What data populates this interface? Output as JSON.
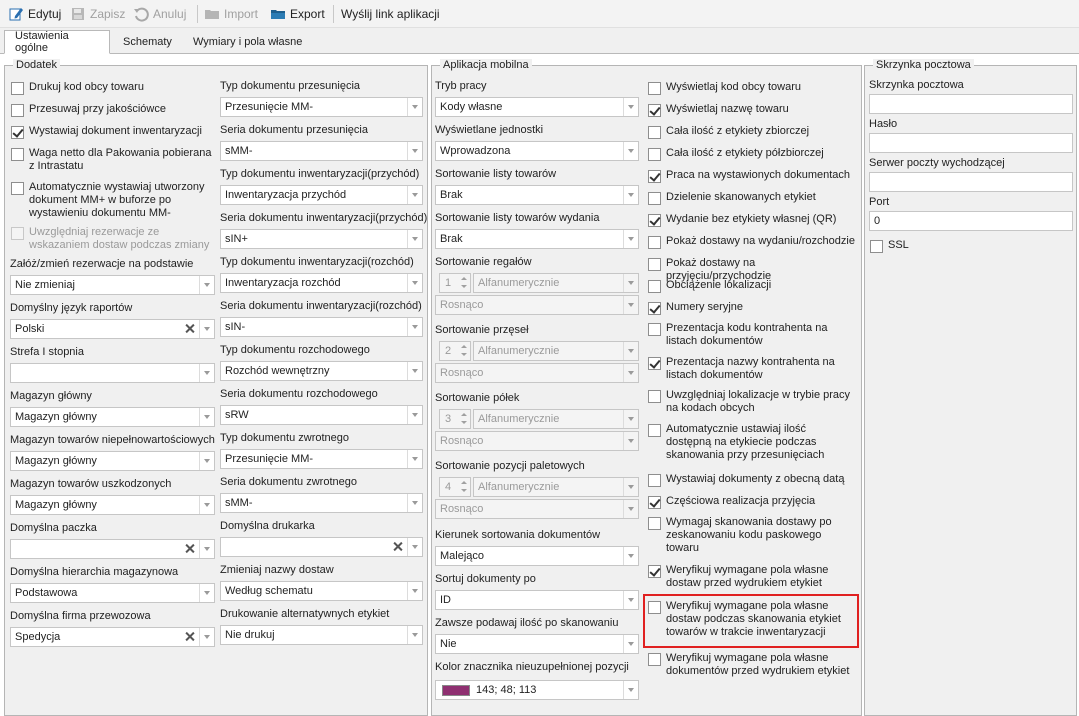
{
  "toolbar": {
    "edit": "Edytuj",
    "save": "Zapisz",
    "cancel": "Anuluj",
    "import": "Import",
    "export": "Export",
    "send_link": "Wyślij link aplikacji"
  },
  "tabs": [
    "Ustawienia ogólne",
    "Schematy",
    "Wymiary i pola własne"
  ],
  "dodatek": {
    "title": "Dodatek",
    "checkboxes": [
      {
        "label": "Drukuj kod obcy towaru",
        "checked": false
      },
      {
        "label": "Przesuwaj przy jakościówce",
        "checked": false
      },
      {
        "label": "Wystawiaj dokument inwentaryzacji",
        "checked": true
      },
      {
        "label": "Waga netto dla Pakowania pobierana\nz Intrastatu",
        "checked": false
      },
      {
        "label": "Automatycznie wystawiaj utworzony\ndokument MM+ w buforze po\nwystawieniu dokumentu MM-",
        "checked": false
      },
      {
        "label": "Uwzględniaj rezerwacje ze\nwskazaniem dostaw podczas zmiany",
        "checked": false,
        "disabled": true
      }
    ],
    "left_fields": [
      {
        "label": "Załóż/zmień rezerwacje na podstawie",
        "value": "Nie zmieniaj"
      },
      {
        "label": "Domyślny język raportów",
        "value": "Polski"
      },
      {
        "label": "Strefa I stopnia",
        "value": ""
      },
      {
        "label": "Magazyn główny",
        "value": "Magazyn główny"
      },
      {
        "label": "Magazyn towarów niepełnowartościowych",
        "value": "Magazyn główny"
      },
      {
        "label": "Magazyn towarów uszkodzonych",
        "value": "Magazyn główny"
      },
      {
        "label": "Domyślna paczka",
        "value": ""
      },
      {
        "label": "Domyślna hierarchia magazynowa",
        "value": "Podstawowa"
      },
      {
        "label": "Domyślna firma przewozowa",
        "value": "Spedycja"
      }
    ],
    "right_fields": [
      {
        "label": "Typ dokumentu przesunięcia",
        "value": "Przesunięcie MM-"
      },
      {
        "label": "Seria dokumentu przesunięcia",
        "value": "sMM-"
      },
      {
        "label": "Typ dokumentu inwentaryzacji(przychód)",
        "value": "Inwentaryzacja przychód"
      },
      {
        "label": "Seria dokumentu inwentaryzacji(przychód)",
        "value": "sIN+"
      },
      {
        "label": "Typ dokumentu inwentaryzacji(rozchód)",
        "value": "Inwentaryzacja rozchód"
      },
      {
        "label": "Seria dokumentu inwentaryzacji(rozchód)",
        "value": "sIN-"
      },
      {
        "label": "Typ dokumentu rozchodowego",
        "value": "Rozchód wewnętrzny"
      },
      {
        "label": "Seria dokumentu rozchodowego",
        "value": "sRW"
      },
      {
        "label": "Typ dokumentu zwrotnego",
        "value": "Przesunięcie MM-"
      },
      {
        "label": "Seria dokumentu zwrotnego",
        "value": "sMM-"
      },
      {
        "label": "Domyślna drukarka",
        "value": ""
      },
      {
        "label": "Zmieniaj nazwy dostaw",
        "value": "Według schematu"
      },
      {
        "label": "Drukowanie alternatywnych etykiet",
        "value": "Nie drukuj"
      }
    ]
  },
  "mobile": {
    "title": "Aplikacja mobilna",
    "fields": [
      {
        "label": "Tryb pracy",
        "value": "Kody własne"
      },
      {
        "label": "Wyświetlane jednostki",
        "value": "Wprowadzona"
      },
      {
        "label": "Sortowanie listy towarów",
        "value": "Brak"
      },
      {
        "label": "Sortowanie listy towarów wydania",
        "value": "Brak"
      }
    ],
    "sort_groups": [
      {
        "label": "Sortowanie regałów",
        "num": "1",
        "type": "Alfanumerycznie",
        "order": "Rosnąco"
      },
      {
        "label": "Sortowanie przęseł",
        "num": "2",
        "type": "Alfanumerycznie",
        "order": "Rosnąco"
      },
      {
        "label": "Sortowanie półek",
        "num": "3",
        "type": "Alfanumerycznie",
        "order": "Rosnąco"
      },
      {
        "label": "Sortowanie pozycji paletowych",
        "num": "4",
        "type": "Alfanumerycznie",
        "order": "Rosnąco"
      }
    ],
    "fields2": [
      {
        "label": "Kierunek sortowania dokumentów",
        "value": "Malejąco"
      },
      {
        "label": "Sortuj dokumenty po",
        "value": "ID"
      },
      {
        "label": "Zawsze podawaj ilość po skanowaniu",
        "value": "Nie"
      }
    ],
    "color": {
      "label": "Kolor znacznika nieuzupełnionej pozycji",
      "value": "143; 48; 113",
      "swatch": "#8f3071"
    },
    "checkboxes": [
      {
        "label": "Wyświetlaj kod obcy towaru",
        "checked": false
      },
      {
        "label": "Wyświetlaj nazwę towaru",
        "checked": true
      },
      {
        "label": "Cała ilość z etykiety zbiorczej",
        "checked": false
      },
      {
        "label": "Cała ilość z etykiety półzbiorczej",
        "checked": false
      },
      {
        "label": "Praca na wystawionych dokumentach",
        "checked": true
      },
      {
        "label": "Dzielenie skanowanych etykiet",
        "checked": false
      },
      {
        "label": "Wydanie bez etykiety własnej (QR)",
        "checked": true
      },
      {
        "label": "Pokaż dostawy na wydaniu/rozchodzie",
        "checked": false
      },
      {
        "label": "Pokaż dostawy na przyjęciu/przychodzie",
        "checked": false
      },
      {
        "label": "Obciążenie lokalizacji",
        "checked": false
      },
      {
        "label": "Numery seryjne",
        "checked": true
      },
      {
        "label": "Prezentacja kodu kontrahenta na\nlistach dokumentów",
        "checked": false
      },
      {
        "label": "Prezentacja nazwy kontrahenta na\nlistach dokumentów",
        "checked": true
      },
      {
        "label": "Uwzględniaj lokalizacje w trybie pracy\nna kodach obcych",
        "checked": false
      },
      {
        "label": "Automatycznie ustawiaj ilość\ndostępną na etykiecie podczas\nskanowania przy przesunięciach",
        "checked": false
      },
      {
        "label": "Wystawiaj dokumenty z obecną datą",
        "checked": false
      },
      {
        "label": "Częściowa realizacja przyjęcia",
        "checked": true
      },
      {
        "label": "Wymagaj skanowania dostawy po\nzeskanowaniu kodu paskowego\ntowaru",
        "checked": false
      },
      {
        "label": "Weryfikuj wymagane pola własne\ndostaw przed wydrukiem etykiet",
        "checked": true
      },
      {
        "label": "Weryfikuj wymagane pola własne\ndostaw podczas skanowania etykiet\ntowarów w trakcie inwentaryzacji",
        "checked": false
      },
      {
        "label": "Weryfikuj wymagane pola własne\ndokumentów przed wydrukiem etykiet",
        "checked": false
      }
    ]
  },
  "mailbox": {
    "title": "Skrzynka pocztowa",
    "fields": [
      {
        "label": "Skrzynka pocztowa",
        "value": ""
      },
      {
        "label": "Hasło",
        "value": ""
      },
      {
        "label": "Serwer poczty wychodzącej",
        "value": ""
      },
      {
        "label": "Port",
        "value": "0"
      }
    ],
    "ssl": {
      "label": "SSL",
      "checked": false
    }
  }
}
